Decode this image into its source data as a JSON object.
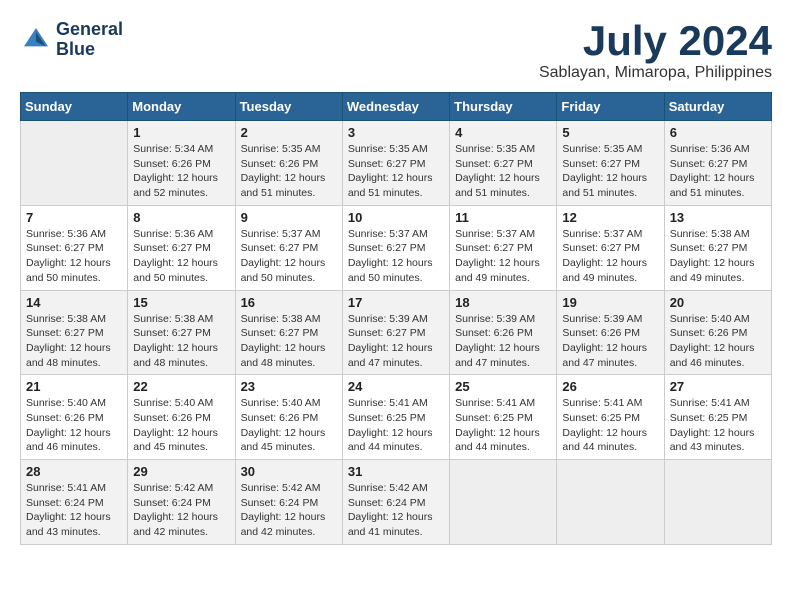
{
  "logo": {
    "line1": "General",
    "line2": "Blue"
  },
  "title": "July 2024",
  "subtitle": "Sablayan, Mimaropa, Philippines",
  "days_of_week": [
    "Sunday",
    "Monday",
    "Tuesday",
    "Wednesday",
    "Thursday",
    "Friday",
    "Saturday"
  ],
  "weeks": [
    [
      {
        "day": "",
        "info": ""
      },
      {
        "day": "1",
        "info": "Sunrise: 5:34 AM\nSunset: 6:26 PM\nDaylight: 12 hours\nand 52 minutes."
      },
      {
        "day": "2",
        "info": "Sunrise: 5:35 AM\nSunset: 6:26 PM\nDaylight: 12 hours\nand 51 minutes."
      },
      {
        "day": "3",
        "info": "Sunrise: 5:35 AM\nSunset: 6:27 PM\nDaylight: 12 hours\nand 51 minutes."
      },
      {
        "day": "4",
        "info": "Sunrise: 5:35 AM\nSunset: 6:27 PM\nDaylight: 12 hours\nand 51 minutes."
      },
      {
        "day": "5",
        "info": "Sunrise: 5:35 AM\nSunset: 6:27 PM\nDaylight: 12 hours\nand 51 minutes."
      },
      {
        "day": "6",
        "info": "Sunrise: 5:36 AM\nSunset: 6:27 PM\nDaylight: 12 hours\nand 51 minutes."
      }
    ],
    [
      {
        "day": "7",
        "info": "Sunrise: 5:36 AM\nSunset: 6:27 PM\nDaylight: 12 hours\nand 50 minutes."
      },
      {
        "day": "8",
        "info": "Sunrise: 5:36 AM\nSunset: 6:27 PM\nDaylight: 12 hours\nand 50 minutes."
      },
      {
        "day": "9",
        "info": "Sunrise: 5:37 AM\nSunset: 6:27 PM\nDaylight: 12 hours\nand 50 minutes."
      },
      {
        "day": "10",
        "info": "Sunrise: 5:37 AM\nSunset: 6:27 PM\nDaylight: 12 hours\nand 50 minutes."
      },
      {
        "day": "11",
        "info": "Sunrise: 5:37 AM\nSunset: 6:27 PM\nDaylight: 12 hours\nand 49 minutes."
      },
      {
        "day": "12",
        "info": "Sunrise: 5:37 AM\nSunset: 6:27 PM\nDaylight: 12 hours\nand 49 minutes."
      },
      {
        "day": "13",
        "info": "Sunrise: 5:38 AM\nSunset: 6:27 PM\nDaylight: 12 hours\nand 49 minutes."
      }
    ],
    [
      {
        "day": "14",
        "info": "Sunrise: 5:38 AM\nSunset: 6:27 PM\nDaylight: 12 hours\nand 48 minutes."
      },
      {
        "day": "15",
        "info": "Sunrise: 5:38 AM\nSunset: 6:27 PM\nDaylight: 12 hours\nand 48 minutes."
      },
      {
        "day": "16",
        "info": "Sunrise: 5:38 AM\nSunset: 6:27 PM\nDaylight: 12 hours\nand 48 minutes."
      },
      {
        "day": "17",
        "info": "Sunrise: 5:39 AM\nSunset: 6:27 PM\nDaylight: 12 hours\nand 47 minutes."
      },
      {
        "day": "18",
        "info": "Sunrise: 5:39 AM\nSunset: 6:26 PM\nDaylight: 12 hours\nand 47 minutes."
      },
      {
        "day": "19",
        "info": "Sunrise: 5:39 AM\nSunset: 6:26 PM\nDaylight: 12 hours\nand 47 minutes."
      },
      {
        "day": "20",
        "info": "Sunrise: 5:40 AM\nSunset: 6:26 PM\nDaylight: 12 hours\nand 46 minutes."
      }
    ],
    [
      {
        "day": "21",
        "info": "Sunrise: 5:40 AM\nSunset: 6:26 PM\nDaylight: 12 hours\nand 46 minutes."
      },
      {
        "day": "22",
        "info": "Sunrise: 5:40 AM\nSunset: 6:26 PM\nDaylight: 12 hours\nand 45 minutes."
      },
      {
        "day": "23",
        "info": "Sunrise: 5:40 AM\nSunset: 6:26 PM\nDaylight: 12 hours\nand 45 minutes."
      },
      {
        "day": "24",
        "info": "Sunrise: 5:41 AM\nSunset: 6:25 PM\nDaylight: 12 hours\nand 44 minutes."
      },
      {
        "day": "25",
        "info": "Sunrise: 5:41 AM\nSunset: 6:25 PM\nDaylight: 12 hours\nand 44 minutes."
      },
      {
        "day": "26",
        "info": "Sunrise: 5:41 AM\nSunset: 6:25 PM\nDaylight: 12 hours\nand 44 minutes."
      },
      {
        "day": "27",
        "info": "Sunrise: 5:41 AM\nSunset: 6:25 PM\nDaylight: 12 hours\nand 43 minutes."
      }
    ],
    [
      {
        "day": "28",
        "info": "Sunrise: 5:41 AM\nSunset: 6:24 PM\nDaylight: 12 hours\nand 43 minutes."
      },
      {
        "day": "29",
        "info": "Sunrise: 5:42 AM\nSunset: 6:24 PM\nDaylight: 12 hours\nand 42 minutes."
      },
      {
        "day": "30",
        "info": "Sunrise: 5:42 AM\nSunset: 6:24 PM\nDaylight: 12 hours\nand 42 minutes."
      },
      {
        "day": "31",
        "info": "Sunrise: 5:42 AM\nSunset: 6:24 PM\nDaylight: 12 hours\nand 41 minutes."
      },
      {
        "day": "",
        "info": ""
      },
      {
        "day": "",
        "info": ""
      },
      {
        "day": "",
        "info": ""
      }
    ]
  ]
}
